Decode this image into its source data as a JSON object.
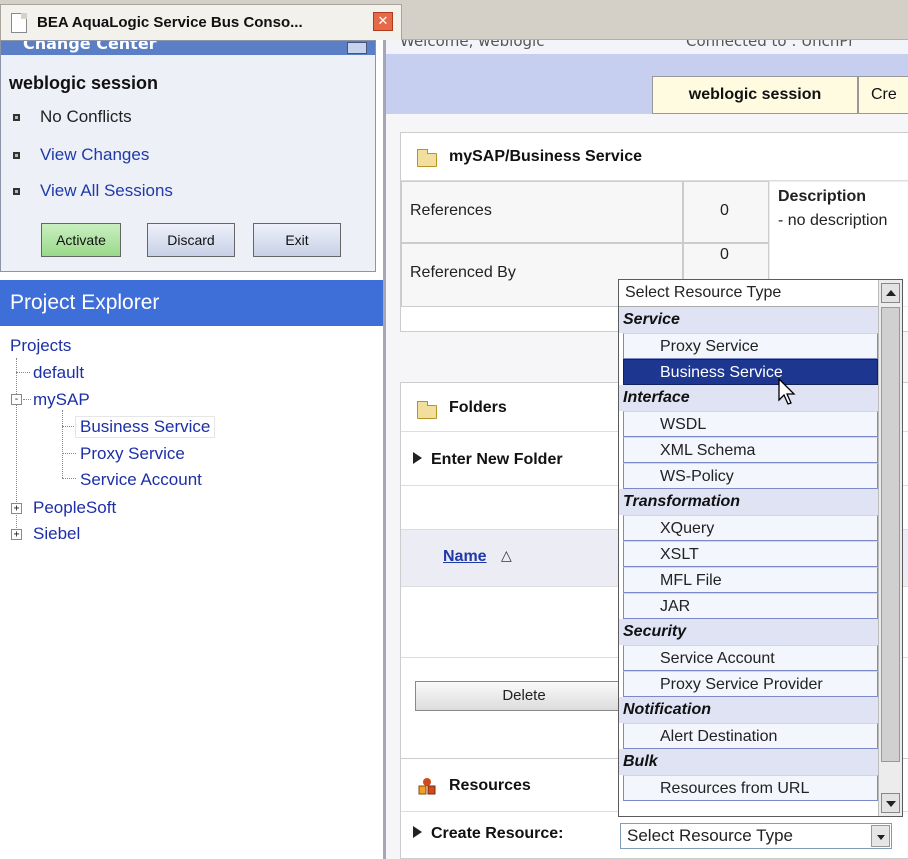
{
  "browser": {
    "tab_title": "BEA AquaLogic Service Bus Conso...",
    "close_glyph": "✕"
  },
  "change_center": {
    "title": "Change Center",
    "session": "weblogic session",
    "no_conflicts": "No Conflicts",
    "view_changes": "View Changes",
    "view_all_sessions": "View All Sessions",
    "buttons": {
      "activate": "Activate",
      "discard": "Discard",
      "exit": "Exit"
    }
  },
  "project_explorer": {
    "title": "Project Explorer",
    "projects_label": "Projects",
    "nodes": {
      "default": "default",
      "mysap": "mySAP",
      "business_service": "Business Service",
      "proxy_service": "Proxy Service",
      "service_account": "Service Account",
      "peoplesoft": "PeopleSoft",
      "siebel": "Siebel"
    }
  },
  "header": {
    "welcome": "Welcome, weblogic",
    "connected": "Connected to : UnchPr",
    "session_tab": "weblogic session",
    "create_tab": "Cre"
  },
  "sap_panel": {
    "title": "mySAP/Business Service",
    "references_label": "References",
    "references_value": "0",
    "referenced_by_label": "Referenced By",
    "referenced_by_value": "0",
    "description_label": "Description",
    "description_value": "- no description"
  },
  "folders_panel": {
    "title": "Folders",
    "enter_new_folder": "Enter New Folder",
    "name_column": "Name",
    "sort_glyph": "△",
    "delete_label": "Delete"
  },
  "resources_panel": {
    "title": "Resources",
    "create_resource_label": "Create Resource:",
    "select_value": "Select Resource Type"
  },
  "dropdown": {
    "header": "Select Resource Type",
    "groups": {
      "service": "Service",
      "interface": "Interface",
      "transformation": "Transformation",
      "security": "Security",
      "notification": "Notification",
      "bulk": "Bulk"
    },
    "options": {
      "proxy_service": "Proxy Service",
      "business_service": "Business Service",
      "wsdl": "WSDL",
      "xml_schema": "XML Schema",
      "ws_policy": "WS-Policy",
      "xquery": "XQuery",
      "xslt": "XSLT",
      "mfl_file": "MFL File",
      "jar": "JAR",
      "service_account": "Service Account",
      "proxy_service_provider": "Proxy Service Provider",
      "alert_destination": "Alert Destination",
      "resources_from_url": "Resources from URL"
    },
    "selected": "Business Service"
  },
  "colors": {
    "explorer_header": "#3e6ed7",
    "link": "#1f3aa8",
    "highlight": "#1d3790",
    "session_bar": "#c7cff1"
  }
}
